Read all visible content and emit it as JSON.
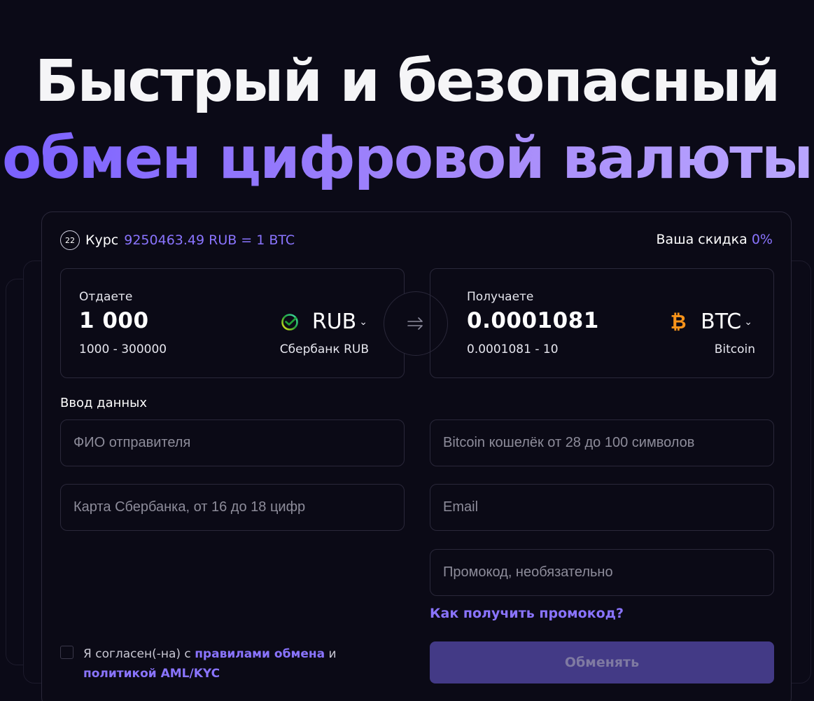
{
  "hero": {
    "line1": "Быстрый и безопасный",
    "line2": "обмен цифровой валюты"
  },
  "rate": {
    "timer": "22",
    "label": "Курс",
    "value": "9250463.49 RUB = 1 BTC"
  },
  "discount": {
    "label": "Ваша скидка",
    "value": "0%"
  },
  "give": {
    "label": "Отдаете",
    "amount": "1 000",
    "range": "1000 - 300000",
    "currency": "RUB",
    "bank": "Сбербанк RUB",
    "icon": "sberbank-icon"
  },
  "receive": {
    "label": "Получаете",
    "amount": "0.0001081",
    "range": "0.0001081 - 10",
    "currency": "BTC",
    "bank": "Bitcoin",
    "icon": "bitcoin-icon"
  },
  "form": {
    "title": "Ввод данных",
    "fio_placeholder": "ФИО отправителя",
    "card_placeholder": "Карта Сбербанка, от 16 до 18 цифр",
    "wallet_placeholder": "Bitcoin кошелёк от 28 до 100 символов",
    "email_placeholder": "Email",
    "promo_placeholder": "Промокод, необязательно",
    "promo_link": "Как получить промокод?",
    "agree_prefix": "Я согласен(-на) с ",
    "agree_rules": "правилами обмена",
    "agree_and": " и ",
    "agree_policy": "политикой AML/KYC",
    "submit": "Обменять"
  },
  "colors": {
    "accent": "#8a74ff",
    "background": "#0b0a17",
    "button": "#433a86",
    "bitcoin": "#f7931a",
    "sber": "#21a038"
  }
}
